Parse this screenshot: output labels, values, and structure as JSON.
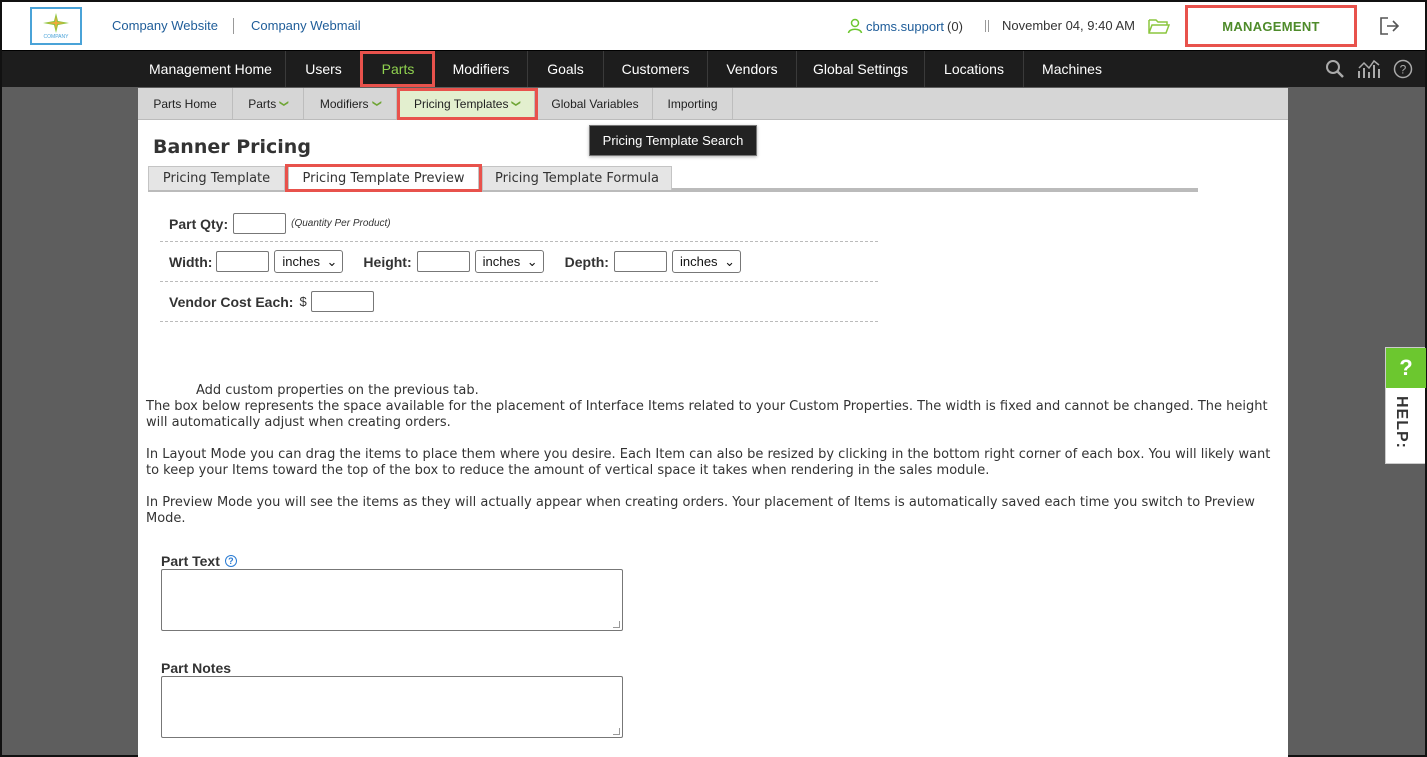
{
  "header": {
    "logo_text": "COMPANY",
    "links": [
      "Company Website",
      "Company Webmail"
    ],
    "user": "cbms.support",
    "user_count": "(0)",
    "datetime": "November 04, 9:40 AM",
    "management_label": "MANAGEMENT"
  },
  "main_nav": {
    "items": [
      "Management Home",
      "Users",
      "Parts",
      "Modifiers",
      "Goals",
      "Customers",
      "Vendors",
      "Global Settings",
      "Locations",
      "Machines"
    ],
    "active": "Parts"
  },
  "sub_nav": {
    "items": [
      "Parts Home",
      "Parts",
      "Modifiers",
      "Pricing Templates",
      "Global Variables",
      "Importing"
    ],
    "active": "Pricing Templates",
    "dropdown_item": "Pricing Template Search"
  },
  "page": {
    "title": "Banner Pricing",
    "tabs": [
      "Pricing Template",
      "Pricing Template Preview",
      "Pricing Template Formula"
    ],
    "active_tab": "Pricing Template Preview"
  },
  "form": {
    "part_qty_label": "Part Qty:",
    "part_qty_note": "(Quantity Per Product)",
    "width_label": "Width:",
    "height_label": "Height:",
    "depth_label": "Depth:",
    "unit": "inches",
    "vendor_cost_label": "Vendor Cost Each:",
    "currency": "$"
  },
  "description": {
    "line1": "Add custom properties on the previous tab.",
    "para1": "The box below represents the space available for the placement of Interface Items related to your Custom Properties. The width is fixed and cannot be changed. The height will automatically adjust when creating orders.",
    "para2": "In Layout Mode you can drag the items to place them where you desire. Each Item can also be resized by clicking in the bottom right corner of each box. You will likely want to keep your Items toward the top of the box to reduce the amount of vertical space it takes when rendering in the sales module.",
    "para3": "In Preview Mode you will see the items as they will actually appear when creating orders. Your placement of Items is automatically saved each time you switch to Preview Mode."
  },
  "fields": {
    "part_text_label": "Part Text",
    "part_notes_label": "Part Notes"
  },
  "help": {
    "label": "HELP:",
    "q": "?"
  },
  "colors": {
    "accent_green": "#8fd14f",
    "highlight_red": "#e8524c",
    "nav_dark": "#1d1d1d"
  }
}
